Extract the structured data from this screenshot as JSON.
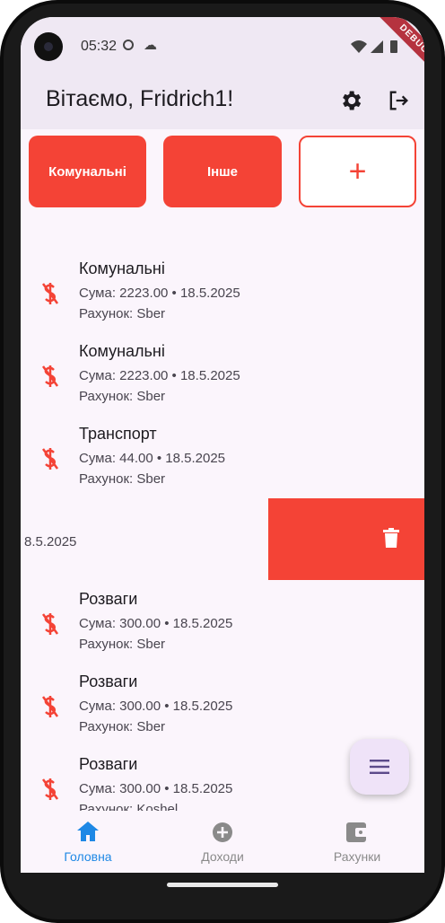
{
  "status_bar": {
    "time": "05:32"
  },
  "debug_banner": "DEBUG",
  "header": {
    "title": "Вітаємо, Fridrich1!"
  },
  "categories": [
    {
      "label": "Комунальні"
    },
    {
      "label": "Інше"
    }
  ],
  "add_category_symbol": "+",
  "transactions": [
    {
      "title": "Комунальні",
      "summary": "Сума: 2223.00 • 18.5.2025",
      "account": "Рахунок: Sber"
    },
    {
      "title": "Комунальні",
      "summary": "Сума: 2223.00 • 18.5.2025",
      "account": "Рахунок: Sber"
    },
    {
      "title": "Транспорт",
      "summary": "Сума: 44.00 • 18.5.2025",
      "account": "Рахунок: Sber"
    },
    {
      "title": "Розваги",
      "summary": "Сума: 300.00 • 18.5.2025",
      "account": "Рахунок: Sber"
    },
    {
      "title": "Розваги",
      "summary": "Сума: 300.00 • 18.5.2025",
      "account": "Рахунок: Sber"
    },
    {
      "title": "Розваги",
      "summary": "Сума: 300.00 • 18.5.2025",
      "account": "Рахунок: Koshel"
    }
  ],
  "swiped_item": {
    "visible_text": "8.5.2025"
  },
  "bottom_nav": [
    {
      "label": "Головна",
      "icon": "home-icon",
      "active": true
    },
    {
      "label": "Доходи",
      "icon": "add-circle-icon",
      "active": false
    },
    {
      "label": "Рахунки",
      "icon": "wallet-icon",
      "active": false
    }
  ],
  "colors": {
    "accent_red": "#f44336",
    "nav_active": "#1e88e5",
    "nav_inactive": "#8a8a8a",
    "header_bg": "#efe8f3",
    "screen_bg": "#fbf5fc"
  }
}
